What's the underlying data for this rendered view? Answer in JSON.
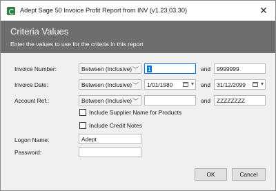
{
  "window": {
    "title": "Adept Sage 50 Invoice Profit Report from INV (v1.23.03.30)"
  },
  "banner": {
    "title": "Criteria Values",
    "subtitle": "Enter the values to use for the criteria in this report"
  },
  "criteria": {
    "invoice_number": {
      "label": "Invoice Number:",
      "operator": "Between (Inclusive)",
      "from": "1",
      "and_label": "and",
      "to": "9999999"
    },
    "invoice_date": {
      "label": "Invoice Date:",
      "operator": "Between (Inclusive)",
      "from": "1/01/1980",
      "and_label": "and",
      "to": "31/12/2099"
    },
    "account_ref": {
      "label": "Account Ref.:",
      "operator": "Between (Inclusive)",
      "from": "",
      "and_label": "and",
      "to": "ZZZZZZZZ"
    }
  },
  "options": {
    "include_supplier": "Include Supplier Name for Products",
    "include_credit_notes": "Include Credit Notes"
  },
  "logon": {
    "name_label": "Logon Name:",
    "name_value": "Adept",
    "password_label": "Password:",
    "password_value": ""
  },
  "buttons": {
    "ok": "OK",
    "cancel": "Cancel"
  }
}
